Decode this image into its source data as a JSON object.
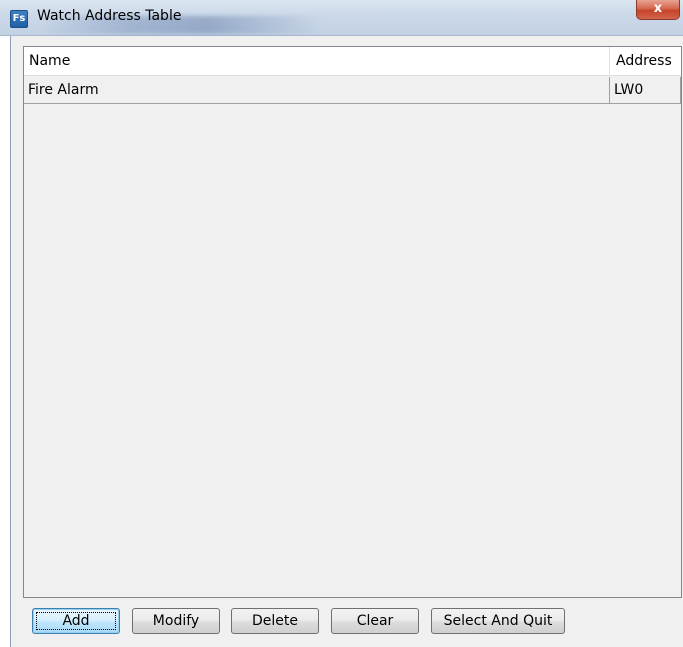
{
  "window": {
    "title": "Watch Address Table",
    "icon_text": "Fs",
    "close_label": "x"
  },
  "table": {
    "columns": [
      "Name",
      "Address"
    ],
    "rows": [
      {
        "name": "Fire Alarm",
        "address": "LW0"
      }
    ]
  },
  "buttons": {
    "add": "Add",
    "modify": "Modify",
    "delete": "Delete",
    "clear": "Clear",
    "select_and_quit": "Select And Quit"
  },
  "colors": {
    "titlebar": "#cbd8e8",
    "client_bg": "#f0f0f0",
    "close_button": "#c6432a",
    "default_button": "#bee6fd"
  },
  "icons": {
    "app": "app-icon",
    "close": "close-icon"
  }
}
